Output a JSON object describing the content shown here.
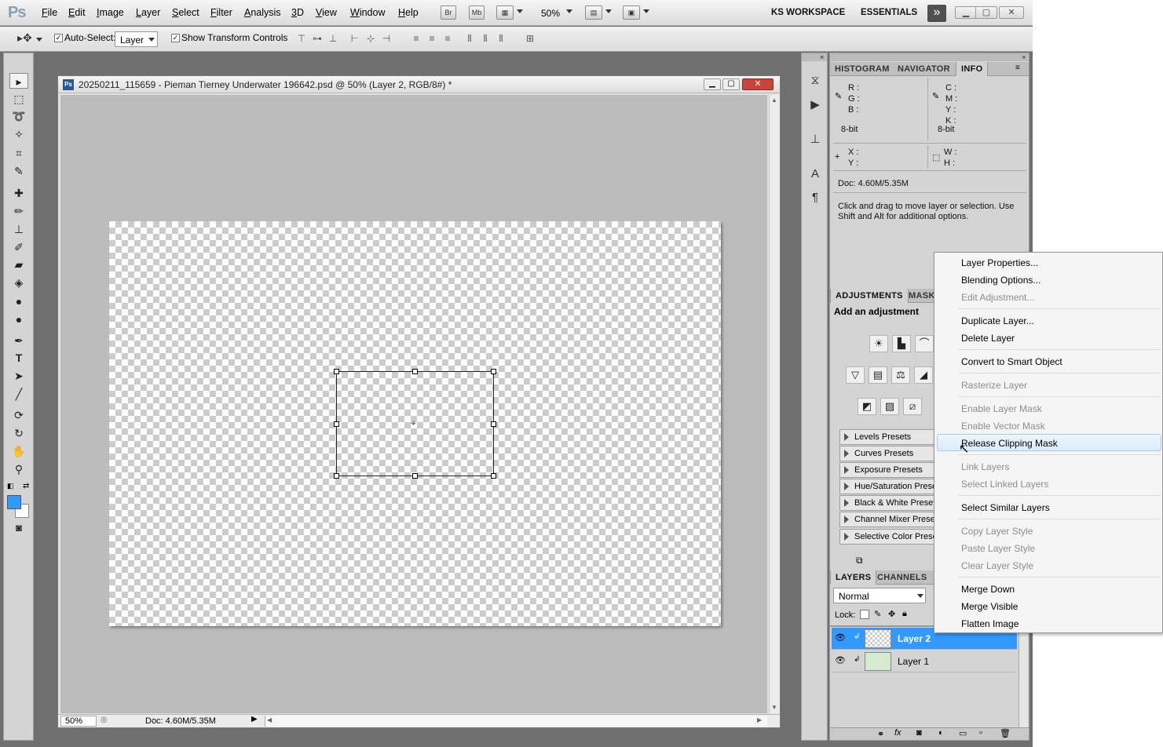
{
  "menubar": {
    "logo": "Ps",
    "menus": [
      "File",
      "Edit",
      "Image",
      "Layer",
      "Select",
      "Filter",
      "Analysis",
      "3D",
      "View",
      "Window",
      "Help"
    ],
    "bridge_label": "Br",
    "minibridge_label": "Mb",
    "zoom": "50%",
    "workspaces": [
      "KS WORKSPACE",
      "ESSENTIALS"
    ],
    "more_label": "»"
  },
  "optionsbar": {
    "auto_select_label": "Auto-Select:",
    "auto_select_value": "Layer",
    "show_transform_label": "Show Transform Controls"
  },
  "document": {
    "title": "20250211_115659 - Pieman Tierney Underwater 196642.psd @ 50% (Layer 2, RGB/8#) *",
    "zoom": "50%",
    "doc_size": "Doc: 4.60M/5.35M"
  },
  "info_panel": {
    "tabs": [
      "HISTOGRAM",
      "NAVIGATOR",
      "INFO"
    ],
    "active_tab": "INFO",
    "rgb_labels": [
      "R :",
      "G :",
      "B :"
    ],
    "cmyk_labels": [
      "C :",
      "M :",
      "Y :",
      "K :"
    ],
    "bit_left": "8-bit",
    "bit_right": "8-bit",
    "xy_labels": [
      "X :",
      "Y :"
    ],
    "wh_labels": [
      "W :",
      "H :"
    ],
    "doc_size": "Doc: 4.60M/5.35M",
    "hint": "Click and drag to move layer or selection.  Use Shift and Alt for additional options."
  },
  "adjustments_panel": {
    "tabs": [
      "ADJUSTMENTS",
      "MASKS"
    ],
    "heading": "Add an adjustment",
    "presets": [
      "Levels Presets",
      "Curves Presets",
      "Exposure Presets",
      "Hue/Saturation Presets",
      "Black & White Presets",
      "Channel Mixer Presets",
      "Selective Color Presets"
    ]
  },
  "layers_panel": {
    "tabs": [
      "LAYERS",
      "CHANNELS"
    ],
    "blend_mode": "Normal",
    "lock_label": "Lock:",
    "layers": [
      {
        "name": "Layer 2",
        "selected": true
      },
      {
        "name": "Layer 1",
        "selected": false
      }
    ]
  },
  "context_menu": {
    "groups": [
      [
        {
          "label": "Layer Properties...",
          "enabled": true
        },
        {
          "label": "Blending Options...",
          "enabled": true
        },
        {
          "label": "Edit Adjustment...",
          "enabled": false
        }
      ],
      [
        {
          "label": "Duplicate Layer...",
          "enabled": true
        },
        {
          "label": "Delete Layer",
          "enabled": true
        }
      ],
      [
        {
          "label": "Convert to Smart Object",
          "enabled": true
        }
      ],
      [
        {
          "label": "Rasterize Layer",
          "enabled": false
        }
      ],
      [
        {
          "label": "Enable Layer Mask",
          "enabled": false
        },
        {
          "label": "Enable Vector Mask",
          "enabled": false
        },
        {
          "label": "Release Clipping Mask",
          "enabled": true,
          "highlighted": true
        }
      ],
      [
        {
          "label": "Link Layers",
          "enabled": false
        },
        {
          "label": "Select Linked Layers",
          "enabled": false
        }
      ],
      [
        {
          "label": "Select Similar Layers",
          "enabled": true
        }
      ],
      [
        {
          "label": "Copy Layer Style",
          "enabled": false
        },
        {
          "label": "Paste Layer Style",
          "enabled": false
        },
        {
          "label": "Clear Layer Style",
          "enabled": false
        }
      ],
      [
        {
          "label": "Merge Down",
          "enabled": true
        },
        {
          "label": "Merge Visible",
          "enabled": true
        },
        {
          "label": "Flatten Image",
          "enabled": true
        }
      ]
    ]
  },
  "colors": {
    "selection_blue": "#3399ff",
    "foreground_color": "#3399ff",
    "background_color": "#ffffff",
    "close_red": "#c9453b"
  }
}
